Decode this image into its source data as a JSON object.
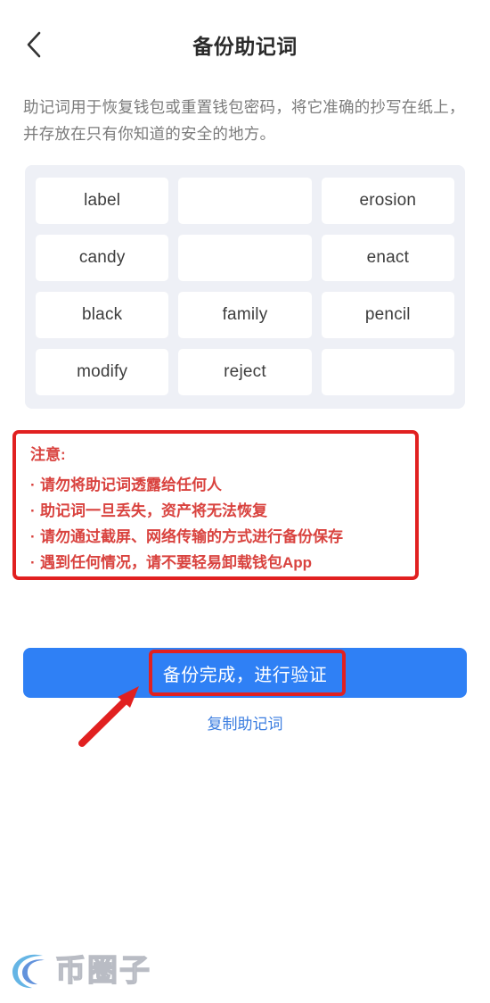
{
  "header": {
    "title": "备份助记词",
    "back_icon": "chevron-left-icon"
  },
  "description": "助记词用于恢复钱包或重置钱包密码，将它准确的抄写在纸上，并存放在只有你知道的安全的地方。",
  "mnemonic": {
    "columns": 3,
    "rows": 4,
    "words": [
      "label",
      "",
      "erosion",
      "candy",
      "",
      "enact",
      "black",
      "family",
      "pencil",
      "modify",
      "reject",
      ""
    ]
  },
  "warning": {
    "title": "注意:",
    "items": [
      "请勿将助记词透露给任何人",
      "助记词一旦丢失，资产将无法恢复",
      "请勿通过截屏、网络传输的方式进行备份保存",
      "遇到任何情况，请不要轻易卸载钱包App"
    ]
  },
  "actions": {
    "primary_label": "备份完成，进行验证",
    "copy_label": "复制助记词"
  },
  "watermark": {
    "text": "币圈子"
  },
  "colors": {
    "primary_blue": "#2f80f5",
    "link_blue": "#3b7de0",
    "annotation_red": "#e12020",
    "warning_text_red": "#d9433f",
    "panel_bg": "#eef0f6",
    "cell_bg": "#ffffff",
    "title_text": "#2b2b2b",
    "description_text": "#7b7b7b",
    "word_text": "#3d3d3d",
    "watermark_stroke": "#b9bcc4"
  }
}
